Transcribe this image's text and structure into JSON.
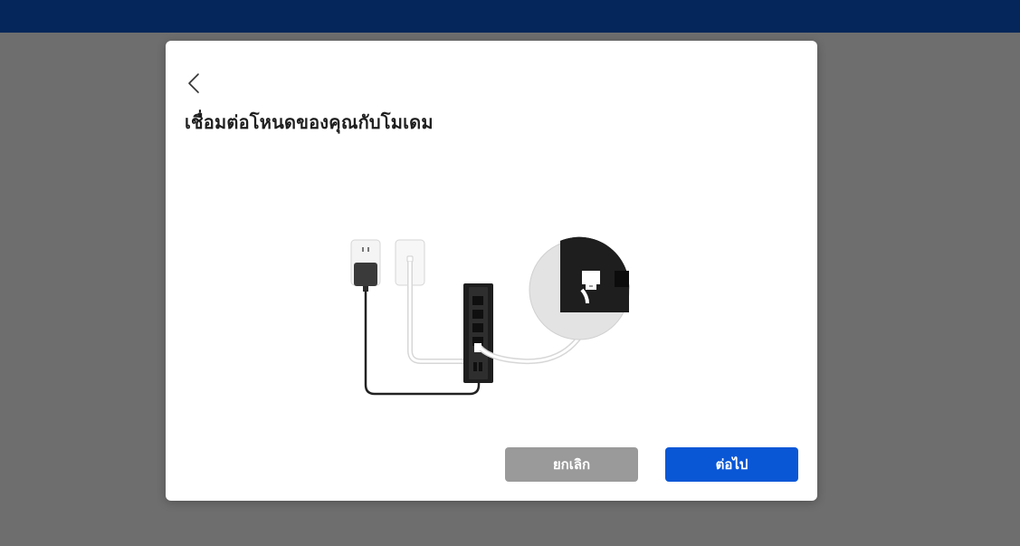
{
  "dialog": {
    "title": "เชื่อมต่อโหนดของคุณกับโมเดม",
    "cancel_label": "ยกเลิก",
    "next_label": "ต่อไป"
  },
  "icons": {
    "back": "chevron-left-icon"
  },
  "colors": {
    "topbar": "#04265a",
    "overlay": "#6e6e6e",
    "dialog_bg": "#ffffff",
    "cancel_button": "#9a9a9a",
    "next_button": "#0a57d6"
  }
}
